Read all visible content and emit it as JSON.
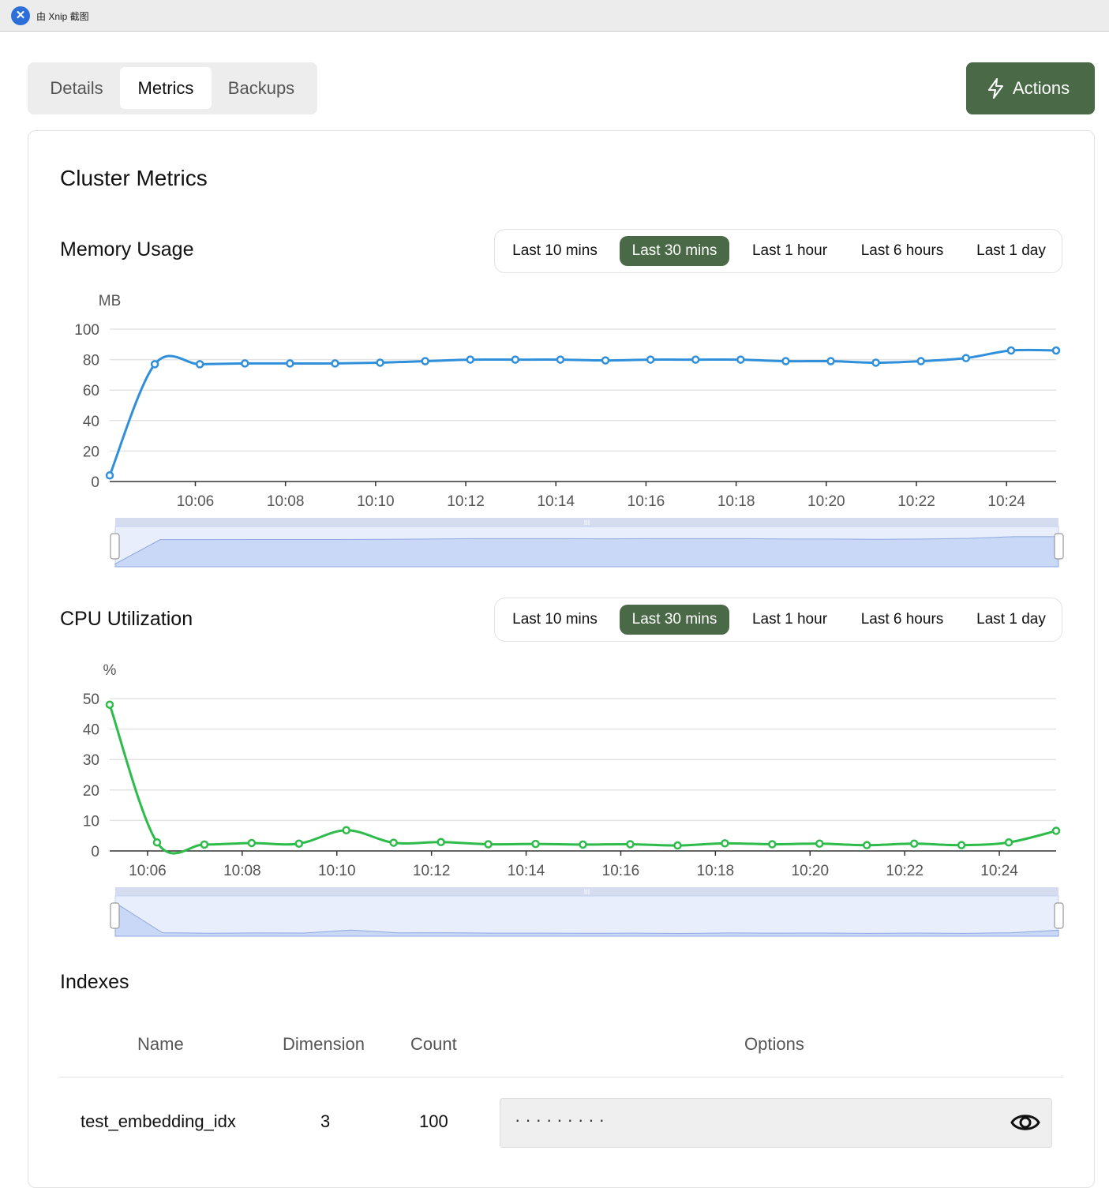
{
  "window": {
    "title": "由 Xnip 截图",
    "icon": "xnip-icon"
  },
  "tabs": [
    {
      "label": "Details",
      "active": false
    },
    {
      "label": "Metrics",
      "active": true
    },
    {
      "label": "Backups",
      "active": false
    }
  ],
  "actions": {
    "label": "Actions",
    "icon": "lightning-icon"
  },
  "page": {
    "title": "Cluster Metrics"
  },
  "ranges": [
    "Last 10 mins",
    "Last 30 mins",
    "Last 1 hour",
    "Last 6 hours",
    "Last 1 day"
  ],
  "selected_range": "Last 30 mins",
  "memory": {
    "title": "Memory Usage",
    "unit": "MB",
    "y_ticks": [
      "100",
      "80",
      "60",
      "40",
      "20",
      "0"
    ],
    "x_ticks": [
      "10:06",
      "10:08",
      "10:10",
      "10:12",
      "10:14",
      "10:16",
      "10:18",
      "10:20",
      "10:22",
      "10:24"
    ]
  },
  "cpu": {
    "title": "CPU Utilization",
    "unit": "%",
    "y_ticks": [
      "50",
      "40",
      "30",
      "20",
      "10",
      "0"
    ],
    "x_ticks": [
      "10:06",
      "10:08",
      "10:10",
      "10:12",
      "10:14",
      "10:16",
      "10:18",
      "10:20",
      "10:22",
      "10:24"
    ]
  },
  "indexes": {
    "title": "Indexes",
    "columns": [
      "Name",
      "Dimension",
      "Count",
      "Options"
    ],
    "rows": [
      {
        "name": "test_embedding_idx",
        "dimension": "3",
        "count": "100",
        "options_masked": "·········"
      }
    ],
    "reveal_icon": "eye-icon"
  },
  "colors": {
    "accent": "#4a6a47",
    "memory_line": "#2f8fdb",
    "cpu_line": "#2dbb4a",
    "zoom_fill": "#c9d8f7"
  },
  "chart_data": [
    {
      "type": "line",
      "title": "Memory Usage",
      "ylabel": "MB",
      "ylim": [
        0,
        100
      ],
      "x_ticks": [
        "10:06",
        "10:08",
        "10:10",
        "10:12",
        "10:14",
        "10:16",
        "10:18",
        "10:20",
        "10:22",
        "10:24"
      ],
      "x_minutes": [
        4.1,
        5.1,
        6.1,
        7.1,
        8.1,
        9.1,
        10.1,
        11.1,
        12.1,
        13.1,
        14.1,
        15.1,
        16.1,
        17.1,
        18.1,
        19.1,
        20.1,
        21.1,
        22.1,
        23.1,
        24.1,
        25.1
      ],
      "series": [
        {
          "values": [
            4,
            77,
            77,
            77.5,
            77.5,
            77.5,
            78,
            79,
            80,
            80,
            80,
            79.5,
            80,
            80,
            80,
            79,
            79,
            78,
            79,
            81,
            86,
            86
          ]
        }
      ],
      "grid": true,
      "has_zoom_slider": true
    },
    {
      "type": "line",
      "title": "CPU Utilization",
      "ylabel": "%",
      "ylim": [
        0,
        50
      ],
      "x_ticks": [
        "10:06",
        "10:08",
        "10:10",
        "10:12",
        "10:14",
        "10:16",
        "10:18",
        "10:20",
        "10:22",
        "10:24"
      ],
      "x_minutes": [
        5.2,
        6.2,
        7.2,
        8.2,
        9.2,
        10.2,
        11.2,
        12.2,
        13.2,
        14.2,
        15.2,
        16.2,
        17.2,
        18.2,
        19.2,
        20.2,
        21.2,
        22.2,
        23.2,
        24.2,
        25.2
      ],
      "series": [
        {
          "values": [
            48,
            2.8,
            2.1,
            2.6,
            2.4,
            6.8,
            2.7,
            2.9,
            2.2,
            2.3,
            2.1,
            2.2,
            1.8,
            2.5,
            2.2,
            2.4,
            1.9,
            2.4,
            1.9,
            2.8,
            6.6
          ]
        }
      ],
      "grid": true,
      "has_zoom_slider": true
    }
  ]
}
